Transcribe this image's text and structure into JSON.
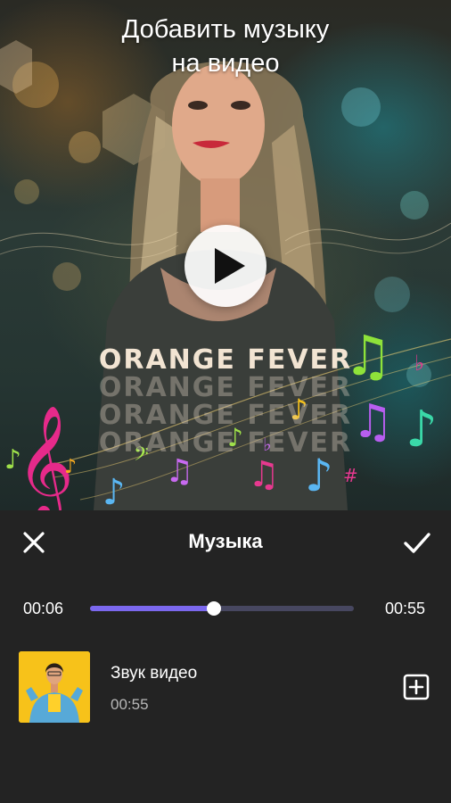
{
  "preview": {
    "headline_line1": "Добавить музыку",
    "headline_line2": "на видео",
    "shirt_text": "ORANGE FEVER",
    "play_icon": "play-icon"
  },
  "toolbar": {
    "title": "Музыка",
    "close_icon": "close-icon",
    "confirm_icon": "check-icon"
  },
  "timeline": {
    "current_time": "00:06",
    "total_time": "00:55",
    "progress": 0.47
  },
  "track": {
    "title": "Звук видео",
    "duration": "00:55",
    "add_icon": "add-box-icon"
  },
  "colors": {
    "accent": "#7b68ee",
    "track_bg": "#474760",
    "background": "#232323",
    "thumb_bg": "#f7c21a"
  }
}
